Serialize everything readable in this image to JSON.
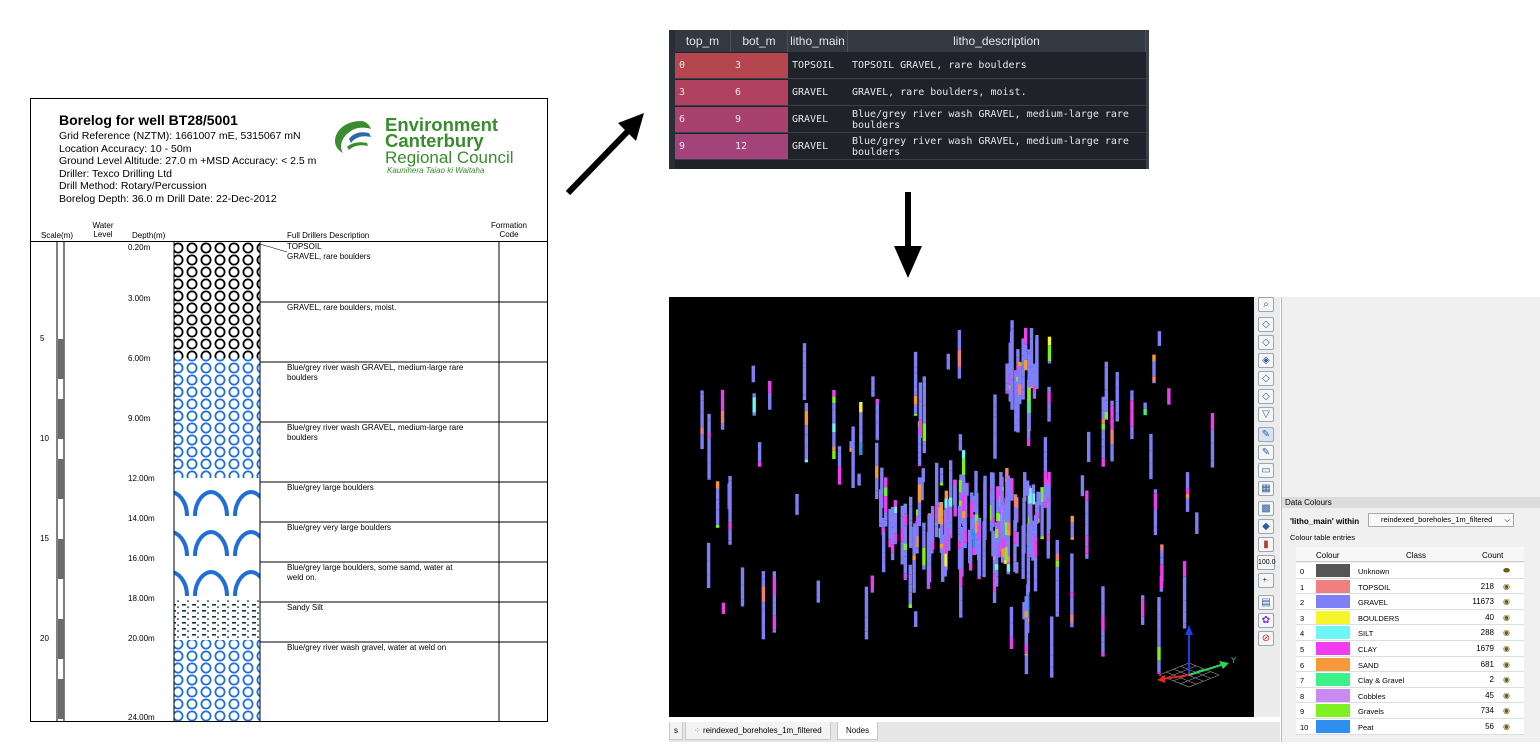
{
  "borelog": {
    "title": "Borelog for well BT28/5001",
    "meta": [
      "Grid Reference (NZTM):  1661007 mE, 5315067 mN",
      "Location Accuracy:  10 - 50m",
      "Ground Level Altitude:  27.0 m +MSD Accuracy:  < 2.5 m",
      "Driller:  Texco Drilling Ltd",
      "Drill Method:  Rotary/Percussion",
      "Borelog Depth:  36.0 m    Drill Date:  22-Dec-2012"
    ],
    "logo": {
      "line1": "Environment",
      "line2": "Canterbury",
      "line3": "Regional Council",
      "line4": "Kaunihera Taiao ki Waitaha",
      "color": "#3a8c2f"
    },
    "headers": {
      "scale": "Scale(m)",
      "water": "Water Level",
      "depth": "Depth(m)",
      "desc": "Full Drillers Description",
      "formation": "Formation Code"
    },
    "scale_labels": [
      "5",
      "10",
      "15",
      "20"
    ],
    "depths": [
      "0.20m",
      "3.00m",
      "6.00m",
      "9.00m",
      "12.00m",
      "14.00m",
      "16.00m",
      "18.00m",
      "20.00m",
      "24.00m"
    ],
    "descriptions": [
      "TOPSOIL",
      "GRAVEL, rare boulders",
      "GRAVEL, rare boulders, moist.",
      "Blue/grey river wash GRAVEL, medium-large rare boulders",
      "Blue/grey river wash GRAVEL, medium-large rare boulders",
      "Blue/grey large boulders",
      "Blue/grey very large boulders",
      "Blue/grey large boulders, some samd, water at weld on.",
      "Sandy Silt",
      "Blue/grey river wash gravel, water at weld on"
    ]
  },
  "table": {
    "columns": [
      "top_m",
      "bot_m",
      "litho_main",
      "litho_description"
    ],
    "rows": [
      [
        "0",
        "3",
        "TOPSOIL",
        "TOPSOIL GRAVEL, rare boulders"
      ],
      [
        "3",
        "6",
        "GRAVEL",
        "GRAVEL, rare boulders, moist."
      ],
      [
        "6",
        "9",
        "GRAVEL",
        "Blue/grey river wash GRAVEL, medium-large rare boulders"
      ],
      [
        "9",
        "12",
        "GRAVEL",
        "Blue/grey river wash GRAVEL, medium-large rare boulders"
      ]
    ],
    "row_colors": [
      "#b5454f",
      "#b04260",
      "#a8416e",
      "#a4427c"
    ]
  },
  "panel": {
    "title": "Data Colours",
    "field_label": "'litho_main' within",
    "layer": "reindexed_boreholes_1m_filtered",
    "section": "Colour table entries",
    "col_colour": "Colour",
    "col_class": "Class",
    "col_count": "Count",
    "scale_value": "100.0",
    "entries": [
      {
        "index": "0",
        "class": "Unknown",
        "count": "",
        "color": "#555555"
      },
      {
        "index": "1",
        "class": "TOPSOIL",
        "count": "218",
        "color": "#f07f80"
      },
      {
        "index": "2",
        "class": "GRAVEL",
        "count": "11673",
        "color": "#7f7ff8"
      },
      {
        "index": "3",
        "class": "BOULDERS",
        "count": "40",
        "color": "#f5f52a"
      },
      {
        "index": "4",
        "class": "SILT",
        "count": "288",
        "color": "#6ef6f6"
      },
      {
        "index": "5",
        "class": "CLAY",
        "count": "1679",
        "color": "#ee3ef0"
      },
      {
        "index": "6",
        "class": "SAND",
        "count": "681",
        "color": "#f5993a"
      },
      {
        "index": "7",
        "class": "Clay & Gravel",
        "count": "2",
        "color": "#3ef08a"
      },
      {
        "index": "8",
        "class": "Cobbles",
        "count": "45",
        "color": "#c98af3"
      },
      {
        "index": "9",
        "class": "Gravels",
        "count": "734",
        "color": "#7ef024"
      },
      {
        "index": "10",
        "class": "Peat",
        "count": "56",
        "color": "#2e8ff0"
      }
    ]
  },
  "tabs": [
    "s",
    "reindexed_boreholes_1m_filtered",
    "Nodes"
  ],
  "axis_label": "Y"
}
